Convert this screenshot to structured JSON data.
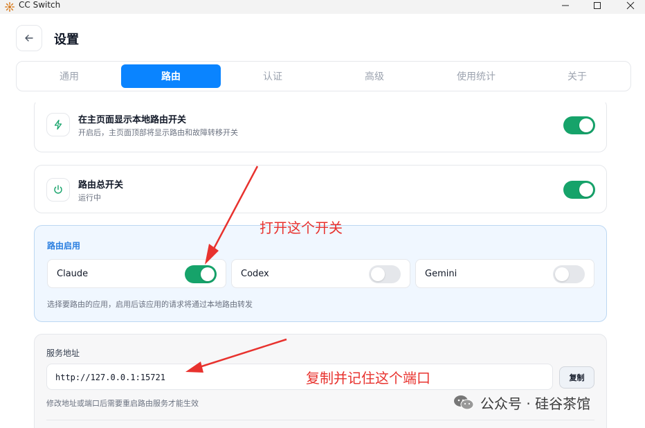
{
  "window": {
    "title": "CC Switch"
  },
  "header": {
    "title": "设置"
  },
  "tabs": [
    {
      "label": "通用",
      "active": false
    },
    {
      "label": "路由",
      "active": true
    },
    {
      "label": "认证",
      "active": false
    },
    {
      "label": "高级",
      "active": false
    },
    {
      "label": "使用统计",
      "active": false
    },
    {
      "label": "关于",
      "active": false
    }
  ],
  "settings": {
    "show_toggle": {
      "title": "在主页面显示本地路由开关",
      "subtitle": "开启后，主页面顶部将显示路由和故障转移开关",
      "enabled": true,
      "icon": "lightning-icon"
    },
    "master_switch": {
      "title": "路由总开关",
      "subtitle": "运行中",
      "enabled": true,
      "icon": "power-icon"
    }
  },
  "routing": {
    "heading": "路由启用",
    "apps": [
      {
        "name": "Claude",
        "enabled": true
      },
      {
        "name": "Codex",
        "enabled": false
      },
      {
        "name": "Gemini",
        "enabled": false
      }
    ],
    "hint": "选择要路由的应用，启用后该应用的请求将通过本地路由转发"
  },
  "service": {
    "label": "服务地址",
    "address": "http://127.0.0.1:15721",
    "copy_label": "复制",
    "hint": "修改地址或端口后需要重启路由服务才能生效"
  },
  "annotations": {
    "toggle_note": "打开这个开关",
    "port_note": "复制并记住这个端口",
    "color": "#e8322e"
  },
  "watermark": {
    "text": "公众号 · 硅谷茶馆"
  },
  "colors": {
    "accent": "#0a84ff",
    "toggle_on": "#16a36a",
    "route_heading": "#2b7fe0"
  }
}
